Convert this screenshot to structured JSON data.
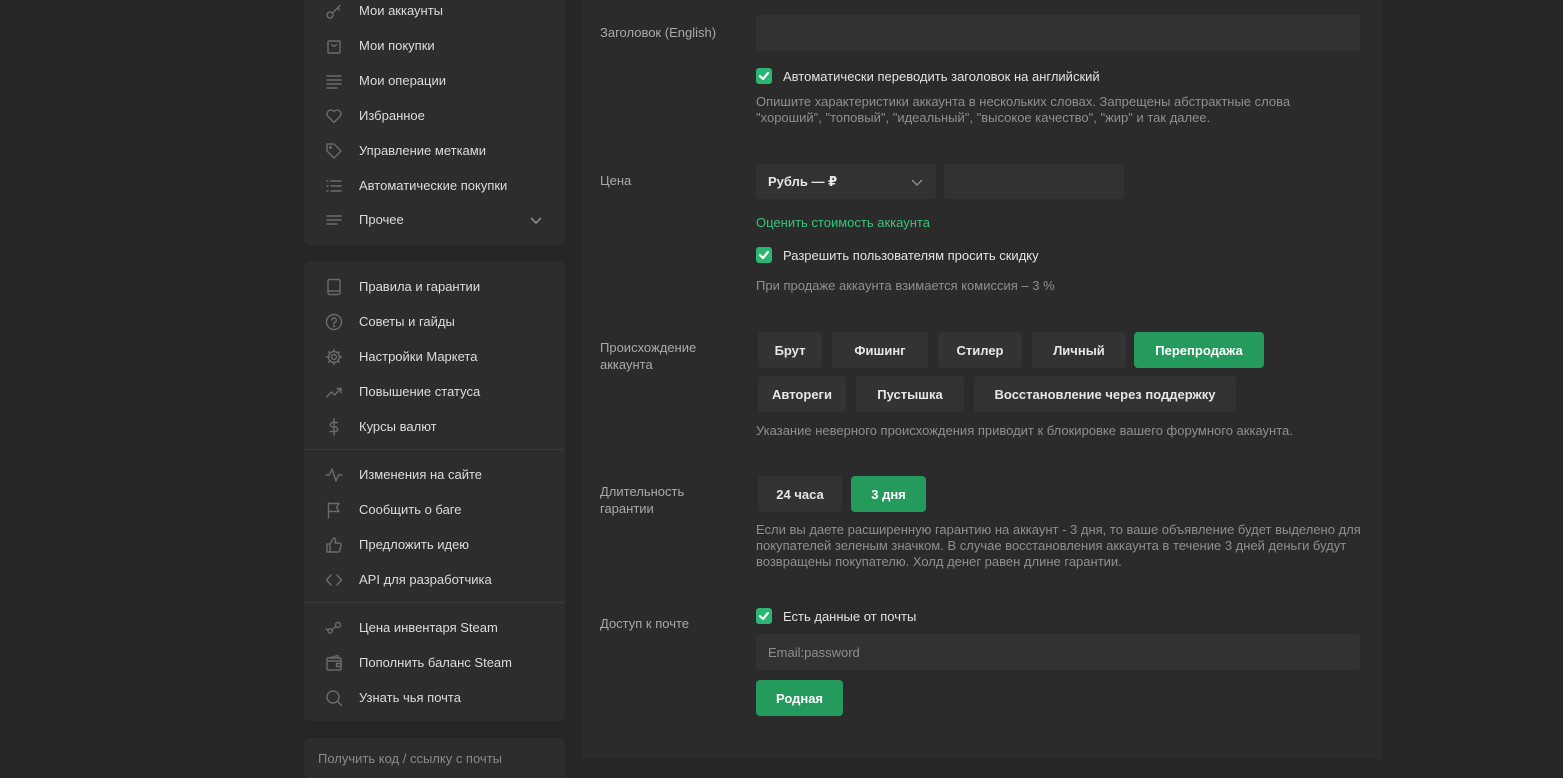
{
  "sidebar": {
    "group1": [
      {
        "label": "Мои аккаунты",
        "icon": "key-icon"
      },
      {
        "label": "Мои покупки",
        "icon": "bag-icon"
      },
      {
        "label": "Мои операции",
        "icon": "lines-icon"
      },
      {
        "label": "Избранное",
        "icon": "heart-icon"
      },
      {
        "label": "Управление метками",
        "icon": "tag-icon"
      },
      {
        "label": "Автоматические покупки",
        "icon": "list-icon"
      },
      {
        "label": "Прочее",
        "icon": "menu-icon"
      }
    ],
    "group2": [
      {
        "label": "Правила и гарантии",
        "icon": "book-icon"
      },
      {
        "label": "Советы и гайды",
        "icon": "question-icon"
      },
      {
        "label": "Настройки Маркета",
        "icon": "gear-icon"
      },
      {
        "label": "Повышение статуса",
        "icon": "trending-icon"
      },
      {
        "label": "Курсы валют",
        "icon": "dollar-icon"
      }
    ],
    "group3": [
      {
        "label": "Изменения на сайте",
        "icon": "activity-icon"
      },
      {
        "label": "Сообщить о баге",
        "icon": "flag-icon"
      },
      {
        "label": "Предложить идею",
        "icon": "thumbs-up-icon"
      },
      {
        "label": "API для разработчика",
        "icon": "code-icon"
      }
    ],
    "group4": [
      {
        "label": "Цена инвентаря Steam",
        "icon": "steam-icon"
      },
      {
        "label": "Пополнить баланс Steam",
        "icon": "wallet-icon"
      },
      {
        "label": "Узнать чья почта",
        "icon": "search-icon"
      }
    ],
    "bottom_peek": "Получить код / ссылку с почты"
  },
  "form": {
    "title_label": "Заголовок (English)",
    "title_value": "",
    "auto_translate": {
      "label": "Автоматически переводить заголовок на английский",
      "checked": true
    },
    "title_hint": "Опишите характеристики аккаунта в нескольких словах. Запрещены абстрактные слова \"хороший\", \"топовый\", \"идеальный\", \"высокое качество\", \"жир\" и так далее.",
    "price_label": "Цена",
    "currency": "Рубль — ₽",
    "price_value": "",
    "estimate_link": "Оценить стоимость аккаунта",
    "allow_discount": {
      "label": "Разрешить пользователям просить скидку",
      "checked": true
    },
    "commission_hint": "При продаже аккаунта взимается комиссия – 3 %",
    "origin_label": "Происхождение аккаунта",
    "origin_options": [
      "Брут",
      "Фишинг",
      "Стилер",
      "Личный",
      "Перепродажа",
      "Автореги",
      "Пустышка",
      "Восстановление через поддержку"
    ],
    "origin_selected": "Перепродажа",
    "origin_hint": "Указание неверного происхождения приводит к блокировке вашего форумного аккаунта.",
    "guarantee_label": "Длительность гарантии",
    "guarantee_options": [
      "24 часа",
      "3 дня"
    ],
    "guarantee_selected": "3 дня",
    "guarantee_hint": "Если вы даете расширенную гарантию на аккаунт - 3 дня, то ваше объявление будет выделено для покупателей зеленым значком. В случае восстановления аккаунта в течение 3 дней деньги будут возвращены покупателю. Холд денег равен длине гарантии.",
    "email_label": "Доступ к почте",
    "email_access": {
      "label": "Есть данные от почты",
      "checked": true
    },
    "email_placeholder": "Email:password",
    "email_type_button": "Родная"
  },
  "colors": {
    "accent": "#249a5d",
    "link": "#34c47c",
    "background": "#262626",
    "panel": "#2d2d2d"
  }
}
